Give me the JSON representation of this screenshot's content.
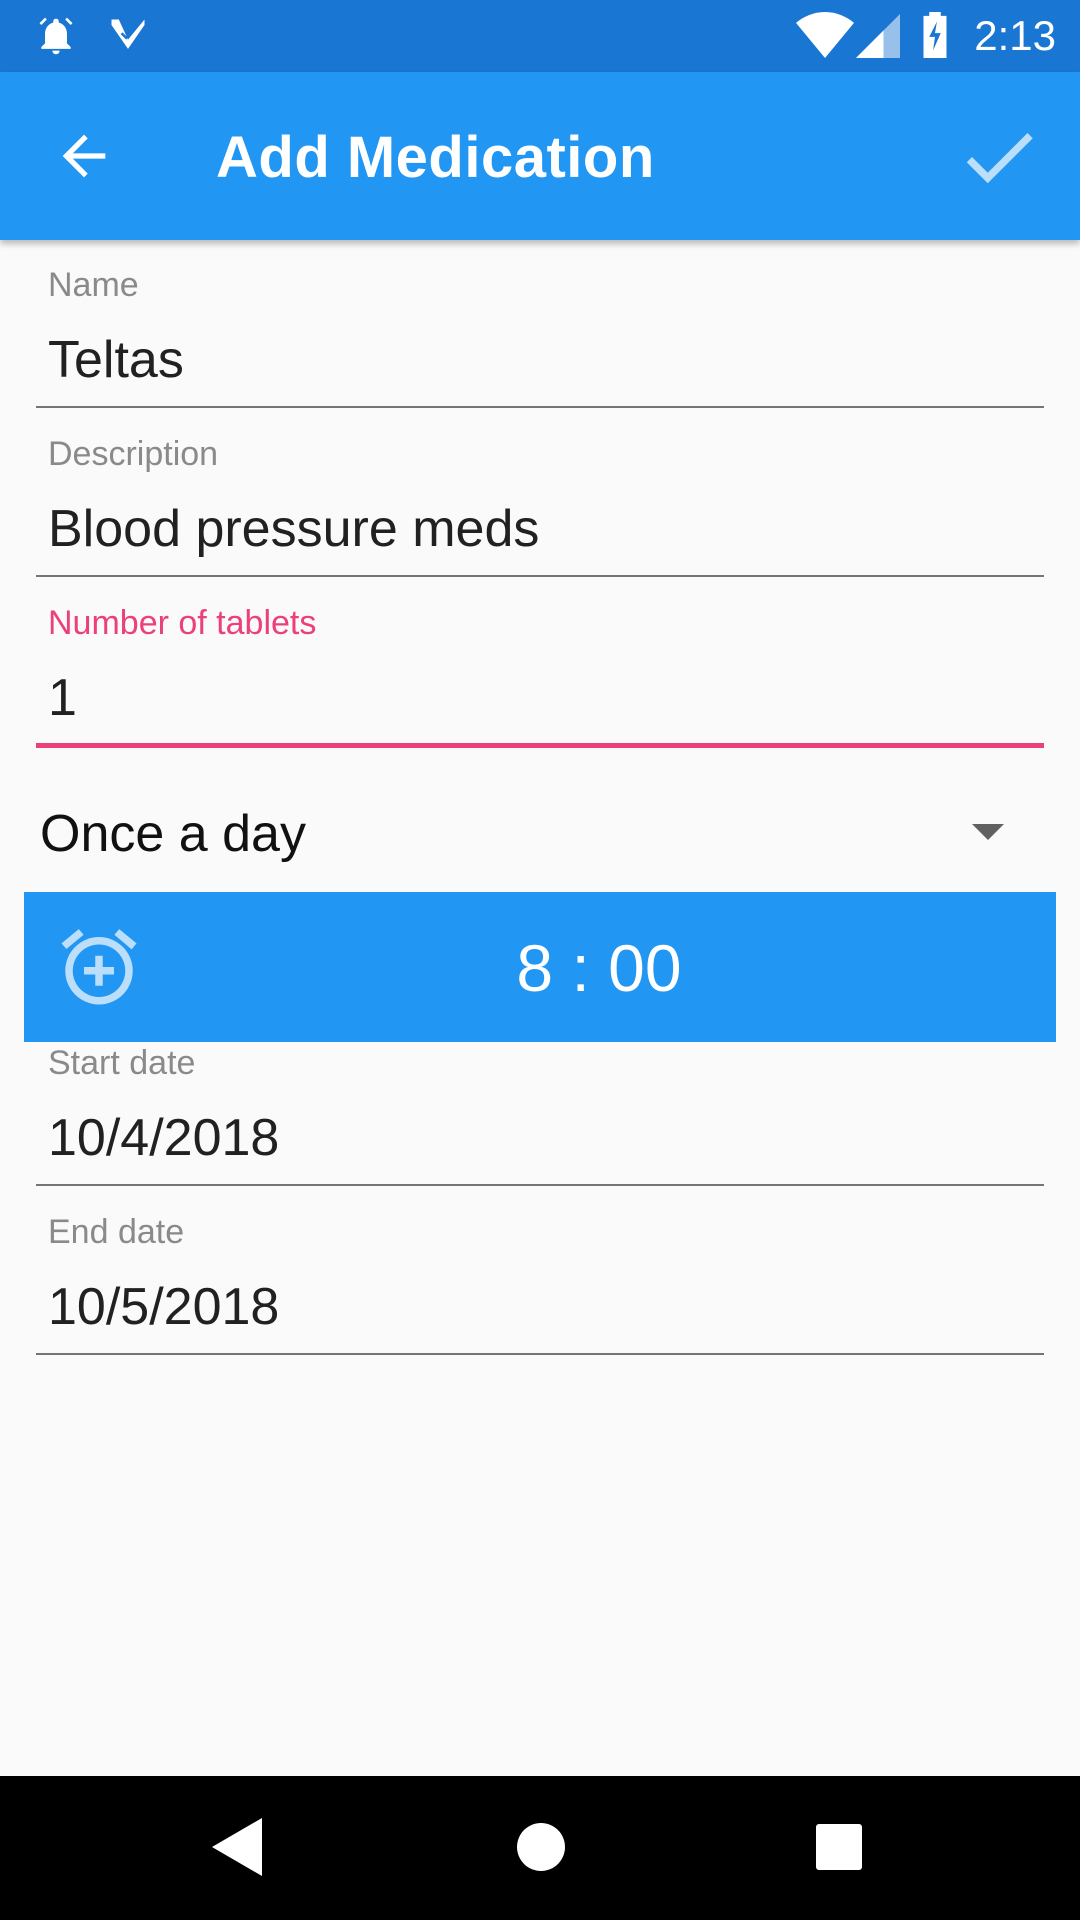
{
  "status_bar": {
    "time": "2:13",
    "icons": [
      "alarm-icon",
      "tasks-check-icon",
      "wifi-icon",
      "signal-icon",
      "battery-charging-icon"
    ]
  },
  "app_bar": {
    "title": "Add Medication",
    "back_icon": "arrow-back-icon",
    "confirm_icon": "check-icon"
  },
  "form": {
    "name": {
      "label": "Name",
      "value": "Teltas"
    },
    "description": {
      "label": "Description",
      "value": "Blood pressure meds"
    },
    "tablets": {
      "label": "Number of tablets",
      "value": "1"
    },
    "frequency": {
      "selected": "Once a day"
    },
    "time": {
      "value": "8 : 00",
      "icon": "alarm-add-icon"
    },
    "start_date": {
      "label": "Start date",
      "value": "10/4/2018"
    },
    "end_date": {
      "label": "End date",
      "value": "10/5/2018"
    }
  },
  "nav_bar": {
    "icons": [
      "back-triangle-icon",
      "home-circle-icon",
      "recents-square-icon"
    ]
  },
  "colors": {
    "primary": "#2196f3",
    "primary_dark": "#1976d2",
    "accent": "#ec407a"
  }
}
